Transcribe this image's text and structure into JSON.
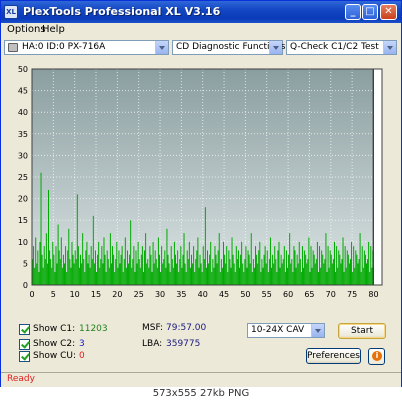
{
  "window": {
    "title": "PlexTools Professional XL V3.16",
    "icon_label": "XL",
    "minimize_glyph": "_",
    "maximize_glyph": "□",
    "close_glyph": "✕"
  },
  "menu": {
    "options": "Options",
    "help": "Help"
  },
  "toolbar": {
    "drive": "HA:0 ID:0  PX-716A",
    "function": "CD Diagnostic Functions",
    "test": "Q-Check C1/C2 Test"
  },
  "options": {
    "show_c1_label": "Show C1:",
    "show_c1_value": "11203",
    "show_c2_label": "Show C2:",
    "show_c2_value": "3",
    "show_cu_label": "Show CU:",
    "show_cu_value": "0"
  },
  "info": {
    "msf_label": "MSF:",
    "msf_value": "79:57.00",
    "lba_label": "LBA:",
    "lba_value": "359775"
  },
  "controls": {
    "speed": "10-24X CAV",
    "start": "Start",
    "preferences": "Preferences",
    "info_glyph": "i"
  },
  "status": {
    "text": "Ready"
  },
  "caption": "573x555  27kb  PNG",
  "colors": {
    "c1_bars": "#00aa00",
    "plot_bg_top": "#8a9ea0",
    "plot_bg_bottom": "#dde5e5",
    "marker_line": "#000000"
  },
  "chart_data": {
    "type": "bar",
    "x_ticks": [
      0,
      5,
      10,
      15,
      20,
      25,
      30,
      35,
      40,
      45,
      50,
      55,
      60,
      65,
      70,
      75,
      80
    ],
    "y_ticks": [
      0,
      5,
      10,
      15,
      20,
      25,
      30,
      35,
      40,
      45,
      50
    ],
    "xlim": [
      0,
      82
    ],
    "ylim": [
      0,
      50
    ],
    "grid": true,
    "end_marker_x": 79.95,
    "series": [
      {
        "x_step": 0.25,
        "values": [
          6,
          9,
          4,
          11,
          5,
          8,
          3,
          10,
          26,
          7,
          4,
          9,
          6,
          12,
          5,
          22,
          8,
          6,
          4,
          10,
          7,
          3,
          9,
          5,
          14,
          8,
          6,
          11,
          4,
          7,
          5,
          9,
          3,
          8,
          13,
          6,
          4,
          10,
          7,
          5,
          8,
          6,
          21,
          9,
          4,
          7,
          5,
          12,
          6,
          3,
          8,
          10,
          5,
          7,
          4,
          9,
          6,
          16,
          5,
          8,
          3,
          7,
          10,
          4,
          6,
          9,
          5,
          11,
          7,
          3,
          8,
          6,
          4,
          12,
          5,
          9,
          7,
          3,
          6,
          10,
          4,
          8,
          5,
          7,
          9,
          3,
          6,
          11,
          4,
          8,
          5,
          7,
          15,
          4,
          6,
          9,
          3,
          8,
          5,
          10,
          6,
          4,
          7,
          9,
          3,
          8,
          12,
          5,
          6,
          4,
          9,
          7,
          3,
          10,
          5,
          8,
          6,
          4,
          11,
          7,
          3,
          9,
          5,
          6,
          8,
          4,
          13,
          7,
          5,
          3,
          9,
          6,
          4,
          10,
          7,
          5,
          8,
          3,
          6,
          9,
          4,
          7,
          12,
          5,
          3,
          8,
          6,
          10,
          4,
          7,
          5,
          9,
          3,
          6,
          8,
          11,
          4,
          7,
          5,
          3,
          9,
          6,
          18,
          4,
          8,
          5,
          7,
          10,
          3,
          6,
          4,
          9,
          7,
          5,
          8,
          12,
          3,
          6,
          4,
          10,
          7,
          5,
          9,
          3,
          8,
          6,
          4,
          11,
          7,
          5,
          3,
          9,
          6,
          8,
          4,
          7,
          10,
          5,
          3,
          6,
          9,
          4,
          8,
          7,
          5,
          12,
          3,
          6,
          4,
          9,
          7,
          5,
          8,
          10,
          3,
          6,
          4,
          7,
          9,
          5,
          8,
          3,
          6,
          11,
          4,
          7,
          5,
          9,
          6,
          3,
          8,
          10,
          4,
          7,
          5,
          6,
          9,
          3,
          8,
          4,
          7,
          12,
          5,
          6,
          3,
          9,
          8,
          4,
          7,
          5,
          10,
          6,
          3,
          9,
          4,
          8,
          7,
          5,
          6,
          11,
          3,
          9,
          4,
          8,
          7,
          5,
          6,
          10,
          3,
          9,
          4,
          8,
          7,
          5,
          6,
          12,
          3,
          9,
          4,
          8,
          7,
          5,
          6,
          10,
          3,
          9,
          4,
          8,
          7,
          5,
          6,
          11,
          3,
          9,
          4,
          8,
          7,
          5,
          6,
          10,
          3,
          9,
          4,
          8,
          7,
          5,
          6,
          12,
          3,
          9,
          4,
          8,
          7,
          5,
          6,
          10,
          3,
          9,
          4,
          8,
          7,
          5,
          6,
          11,
          3,
          9,
          4,
          8,
          7,
          5,
          6,
          10,
          3,
          9,
          4,
          8,
          7,
          5,
          6,
          12,
          3,
          9,
          4,
          8,
          7,
          5,
          6,
          10,
          3,
          9,
          4,
          8,
          7,
          5,
          6
        ]
      }
    ]
  }
}
